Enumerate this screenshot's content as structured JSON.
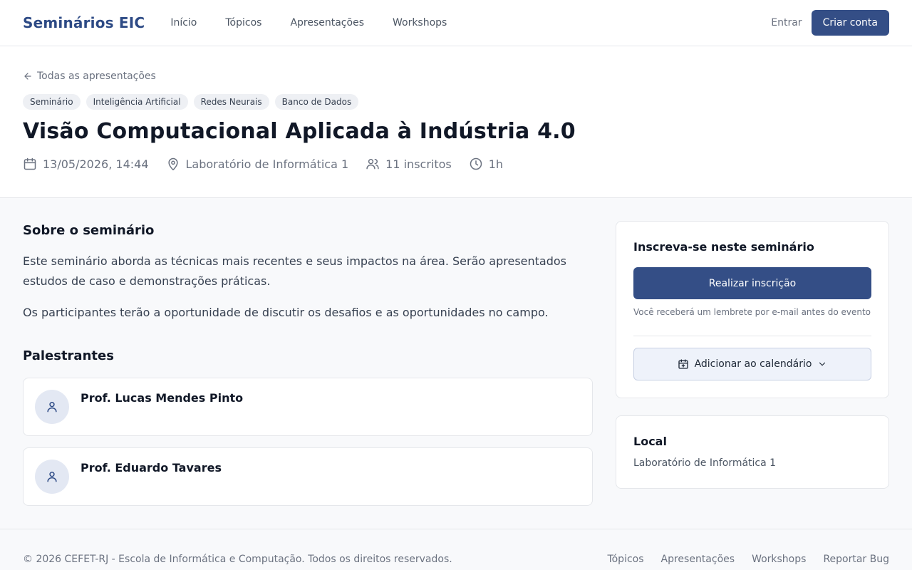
{
  "nav": {
    "brand": "Seminários EIC",
    "links": [
      "Início",
      "Tópicos",
      "Apresentações",
      "Workshops"
    ],
    "login": "Entrar",
    "signup": "Criar conta"
  },
  "header": {
    "back_link": "Todas as apresentações",
    "tags": [
      "Seminário",
      "Inteligência Artificial",
      "Redes Neurais",
      "Banco de Dados"
    ],
    "title": "Visão Computacional Aplicada à Indústria 4.0",
    "meta": {
      "datetime": "13/05/2026, 14:44",
      "location": "Laboratório de Informática 1",
      "enrolled": "11 inscritos",
      "duration": "1h"
    }
  },
  "about": {
    "title": "Sobre o seminário",
    "paragraphs": [
      "Este seminário aborda as técnicas mais recentes e seus impactos na área. Serão apresentados estudos de caso e demonstrações práticas.",
      "Os participantes terão a oportunidade de discutir os desafios e as oportunidades no campo."
    ]
  },
  "speakers": {
    "title": "Palestrantes",
    "items": [
      {
        "name": "Prof. Lucas Mendes Pinto"
      },
      {
        "name": "Prof. Eduardo Tavares"
      }
    ]
  },
  "signup_card": {
    "title": "Inscreva-se neste seminário",
    "register_button": "Realizar inscrição",
    "reminder": "Você receberá um lembrete por e-mail antes do evento",
    "calendar_button": "Adicionar ao calendário"
  },
  "location_card": {
    "title": "Local",
    "value": "Laboratório de Informática 1"
  },
  "footer": {
    "copyright": "© 2026 CEFET-RJ - Escola de Informática e Computação. Todos os direitos reservados.",
    "links": [
      "Tópicos",
      "Apresentações",
      "Workshops",
      "Reportar Bug"
    ]
  },
  "colors": {
    "brand": "#2d4a85",
    "primary_button": "#344e86",
    "calendar_button_bg": "#eef2fa"
  }
}
